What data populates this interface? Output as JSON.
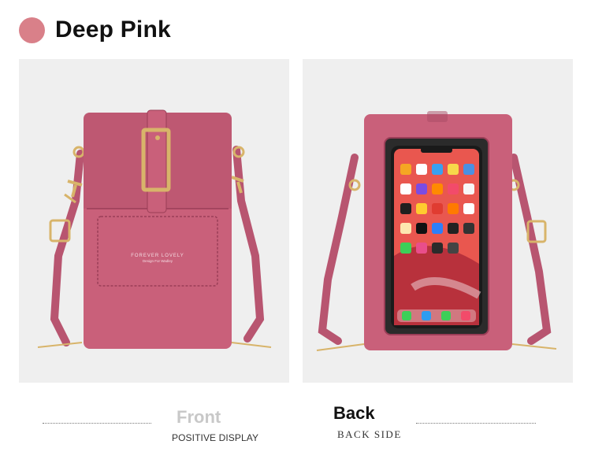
{
  "header": {
    "color_name": "Deep Pink",
    "swatch_color": "#d98089"
  },
  "colors": {
    "bag": "#c9607a",
    "bag_dark": "#a84a63",
    "gold": "#d8b46a",
    "panel_bg": "#efefef"
  },
  "front": {
    "brand_line1": "FOREVER LOVELY",
    "brand_line2": "Design For Wadley",
    "caption_title": "Front",
    "caption_sub": "POSITIVE DISPLAY"
  },
  "back": {
    "caption_title": "Back",
    "caption_sub": "BACK SIDE"
  }
}
